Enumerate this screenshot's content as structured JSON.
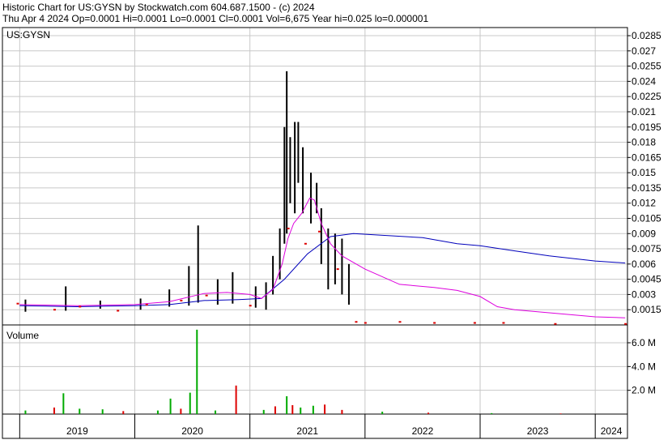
{
  "header": {
    "line1": "Historic Chart for US:GYSN by Stockwatch.com 604.687.1500 - (c) 2024",
    "line2": "Thu Apr  4 2024   Op=0.0001   Hi=0.0001   Lo=0.0001   Cl=0.0001   Vol=6,675   Year hi=0.025   lo=0.000001"
  },
  "chart_data": [
    {
      "type": "line",
      "title": "US:GYSN",
      "y_ticks": [
        "0.0015",
        "0.003",
        "0.0045",
        "0.006",
        "0.0075",
        "0.009",
        "0.0105",
        "0.012",
        "0.0135",
        "0.015",
        "0.0165",
        "0.018",
        "0.0195",
        "0.021",
        "0.0225",
        "0.024",
        "0.0255",
        "0.027",
        "0.0285"
      ],
      "ylim": [
        0,
        0.0293
      ],
      "x_ticks": [
        "2019",
        "2020",
        "2021",
        "2022",
        "2023",
        "2024"
      ],
      "grid": true,
      "colors": {
        "price": "#000000",
        "close_dot": "#dd0000",
        "ma_short": "#dd00dd",
        "ma_long": "#0000bb"
      },
      "price_bars": [
        {
          "t": 2019.05,
          "low": 0.0013,
          "high": 0.0025
        },
        {
          "t": 2019.4,
          "low": 0.0014,
          "high": 0.0038
        },
        {
          "t": 2019.7,
          "low": 0.0016,
          "high": 0.0024
        },
        {
          "t": 2020.05,
          "low": 0.0015,
          "high": 0.0026
        },
        {
          "t": 2020.3,
          "low": 0.0018,
          "high": 0.0035
        },
        {
          "t": 2020.47,
          "low": 0.0019,
          "high": 0.0058
        },
        {
          "t": 2020.55,
          "low": 0.0022,
          "high": 0.0098
        },
        {
          "t": 2020.72,
          "low": 0.002,
          "high": 0.0045
        },
        {
          "t": 2020.85,
          "low": 0.0021,
          "high": 0.0052
        },
        {
          "t": 2021.05,
          "low": 0.0017,
          "high": 0.0038
        },
        {
          "t": 2021.14,
          "low": 0.0015,
          "high": 0.0042
        },
        {
          "t": 2021.2,
          "low": 0.003,
          "high": 0.0068
        },
        {
          "t": 2021.26,
          "low": 0.0045,
          "high": 0.0095
        },
        {
          "t": 2021.3,
          "low": 0.008,
          "high": 0.0195
        },
        {
          "t": 2021.32,
          "low": 0.009,
          "high": 0.025
        },
        {
          "t": 2021.35,
          "low": 0.012,
          "high": 0.0185
        },
        {
          "t": 2021.39,
          "low": 0.011,
          "high": 0.02
        },
        {
          "t": 2021.42,
          "low": 0.014,
          "high": 0.02
        },
        {
          "t": 2021.46,
          "low": 0.011,
          "high": 0.0175
        },
        {
          "t": 2021.53,
          "low": 0.01,
          "high": 0.015
        },
        {
          "t": 2021.58,
          "low": 0.011,
          "high": 0.014
        },
        {
          "t": 2021.62,
          "low": 0.006,
          "high": 0.0115
        },
        {
          "t": 2021.68,
          "low": 0.0035,
          "high": 0.0095
        },
        {
          "t": 2021.74,
          "low": 0.004,
          "high": 0.009
        },
        {
          "t": 2021.8,
          "low": 0.003,
          "high": 0.0085
        },
        {
          "t": 2021.86,
          "low": 0.002,
          "high": 0.006
        }
      ],
      "ma_short": {
        "t": [
          2019.0,
          2019.5,
          2020.0,
          2020.3,
          2020.6,
          2020.8,
          2021.0,
          2021.1,
          2021.2,
          2021.28,
          2021.33,
          2021.38,
          2021.45,
          2021.52,
          2021.56,
          2021.62,
          2021.7,
          2021.8,
          2022.0,
          2022.3,
          2022.6,
          2022.8,
          2023.0,
          2023.15,
          2023.3,
          2023.6,
          2024.0,
          2024.26
        ],
        "v": [
          0.002,
          0.0019,
          0.002,
          0.0023,
          0.0031,
          0.0032,
          0.003,
          0.0026,
          0.0035,
          0.006,
          0.0085,
          0.01,
          0.011,
          0.0125,
          0.0123,
          0.01,
          0.008,
          0.0068,
          0.0055,
          0.004,
          0.0037,
          0.0034,
          0.0028,
          0.0018,
          0.0015,
          0.0012,
          0.0008,
          0.0007
        ]
      },
      "ma_long": {
        "t": [
          2019.0,
          2019.5,
          2020.0,
          2020.3,
          2020.6,
          2020.9,
          2021.1,
          2021.3,
          2021.5,
          2021.7,
          2021.9,
          2022.2,
          2022.5,
          2022.8,
          2023.0,
          2023.3,
          2023.6,
          2024.0,
          2024.26
        ],
        "v": [
          0.0019,
          0.0018,
          0.0019,
          0.002,
          0.0024,
          0.0025,
          0.0026,
          0.0045,
          0.007,
          0.0087,
          0.009,
          0.0088,
          0.0086,
          0.008,
          0.0078,
          0.0073,
          0.0068,
          0.0063,
          0.0061
        ]
      },
      "close_dots": [
        {
          "t": 2018.98,
          "v": 0.0021
        },
        {
          "t": 2019.3,
          "v": 0.0015
        },
        {
          "t": 2019.52,
          "v": 0.0018
        },
        {
          "t": 2019.85,
          "v": 0.0014
        },
        {
          "t": 2020.1,
          "v": 0.002
        },
        {
          "t": 2020.4,
          "v": 0.0024
        },
        {
          "t": 2020.62,
          "v": 0.0029
        },
        {
          "t": 2021.0,
          "v": 0.0019
        },
        {
          "t": 2021.33,
          "v": 0.0095
        },
        {
          "t": 2021.48,
          "v": 0.008
        },
        {
          "t": 2021.6,
          "v": 0.0092
        },
        {
          "t": 2021.76,
          "v": 0.0055
        },
        {
          "t": 2021.92,
          "v": 0.0003
        },
        {
          "t": 2022.0,
          "v": 0.0002
        },
        {
          "t": 2022.3,
          "v": 0.0003
        },
        {
          "t": 2022.6,
          "v": 0.0002
        },
        {
          "t": 2022.95,
          "v": 0.0002
        },
        {
          "t": 2023.2,
          "v": 0.0002
        },
        {
          "t": 2023.65,
          "v": 0.0001
        },
        {
          "t": 2024.26,
          "v": 0.0001
        }
      ]
    },
    {
      "type": "bar",
      "title": "Volume",
      "y_ticks": [
        "2.0 M",
        "4.0 M",
        "6.0 M"
      ],
      "ylim": [
        0,
        7500000
      ],
      "colors": {
        "up": "#00aa00",
        "down": "#dd0000"
      },
      "bars": [
        {
          "t": 2019.05,
          "v": 300000,
          "dir": "up"
        },
        {
          "t": 2019.3,
          "v": 550000,
          "dir": "down"
        },
        {
          "t": 2019.38,
          "v": 1750000,
          "dir": "up"
        },
        {
          "t": 2019.52,
          "v": 450000,
          "dir": "up"
        },
        {
          "t": 2019.72,
          "v": 400000,
          "dir": "up"
        },
        {
          "t": 2019.9,
          "v": 250000,
          "dir": "down"
        },
        {
          "t": 2020.2,
          "v": 300000,
          "dir": "up"
        },
        {
          "t": 2020.31,
          "v": 1300000,
          "dir": "up"
        },
        {
          "t": 2020.4,
          "v": 450000,
          "dir": "down"
        },
        {
          "t": 2020.54,
          "v": 7100000,
          "dir": "up"
        },
        {
          "t": 2020.48,
          "v": 1800000,
          "dir": "up"
        },
        {
          "t": 2020.7,
          "v": 300000,
          "dir": "up"
        },
        {
          "t": 2020.88,
          "v": 2400000,
          "dir": "down"
        },
        {
          "t": 2021.12,
          "v": 350000,
          "dir": "up"
        },
        {
          "t": 2021.22,
          "v": 650000,
          "dir": "down"
        },
        {
          "t": 2021.32,
          "v": 1500000,
          "dir": "up"
        },
        {
          "t": 2021.37,
          "v": 750000,
          "dir": "down"
        },
        {
          "t": 2021.44,
          "v": 550000,
          "dir": "up"
        },
        {
          "t": 2021.55,
          "v": 700000,
          "dir": "up"
        },
        {
          "t": 2021.65,
          "v": 800000,
          "dir": "down"
        },
        {
          "t": 2021.8,
          "v": 350000,
          "dir": "down"
        },
        {
          "t": 2022.15,
          "v": 200000,
          "dir": "up"
        },
        {
          "t": 2022.55,
          "v": 120000,
          "dir": "down"
        },
        {
          "t": 2023.1,
          "v": 80000,
          "dir": "up"
        },
        {
          "t": 2023.7,
          "v": 50000,
          "dir": "down"
        }
      ]
    }
  ]
}
